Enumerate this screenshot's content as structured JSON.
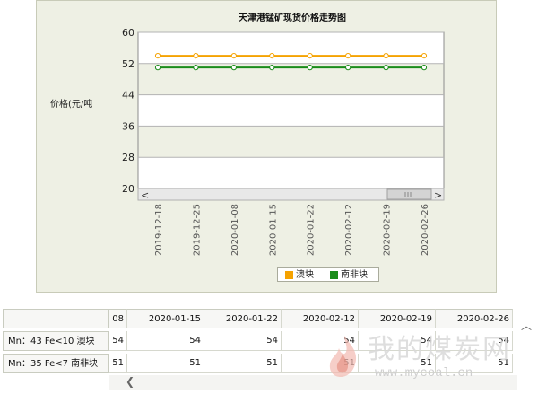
{
  "chart_data": {
    "type": "line",
    "title": "天津港锰矿现货价格走势图",
    "ylabel": "价格(元/吨",
    "ylim": [
      20,
      60
    ],
    "yticks": [
      20,
      28,
      36,
      44,
      52,
      60
    ],
    "categories": [
      "2019-12-18",
      "2019-12-25",
      "2020-01-08",
      "2020-01-15",
      "2020-01-22",
      "2020-02-12",
      "2020-02-19",
      "2020-02-26"
    ],
    "series": [
      {
        "name": "澳块",
        "color": "#f5a200",
        "values": [
          54,
          54,
          54,
          54,
          54,
          54,
          54,
          54
        ]
      },
      {
        "name": "南非块",
        "color": "#1a8c1a",
        "values": [
          51,
          51,
          51,
          51,
          51,
          51,
          51,
          51
        ]
      }
    ],
    "grid": true,
    "legend_position": "bottom"
  },
  "table": {
    "partial_header": "08",
    "headers": [
      "2020-01-15",
      "2020-01-22",
      "2020-02-12",
      "2020-02-19",
      "2020-02-26"
    ],
    "rows": [
      {
        "label": "Mn：43 Fe<10 澳块",
        "partial": "54",
        "values": [
          "54",
          "54",
          "54",
          "54",
          "54"
        ]
      },
      {
        "label": "Mn：35 Fe<7 南非块",
        "partial": "51",
        "values": [
          "51",
          "51",
          "51",
          "51",
          "51"
        ]
      }
    ]
  },
  "watermark": {
    "text": "我的煤炭网",
    "url": "www.mycoal.cn"
  },
  "icons": [
    "chevron-left-icon",
    "chevron-right-icon",
    "chevron-up-icon",
    "scroll-thumb-grip-icon",
    "coal-flame-logo-icon"
  ]
}
